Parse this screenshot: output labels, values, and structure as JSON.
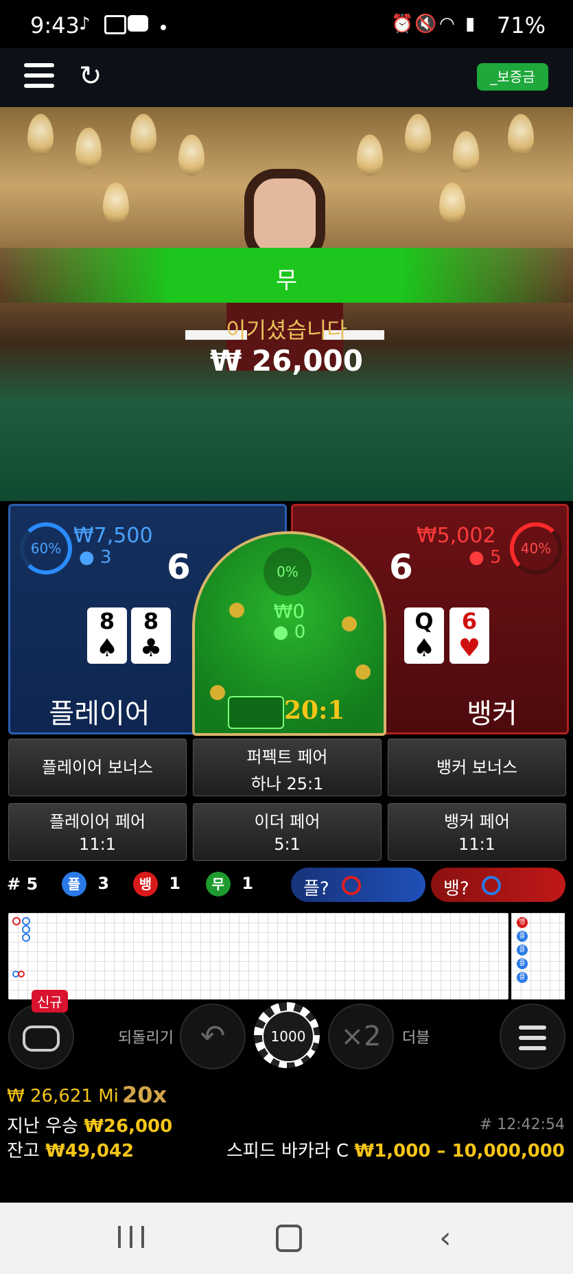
{
  "status_bar": {
    "time": "9:43",
    "battery": "71%"
  },
  "top_bar": {
    "deposit_label": "_보증금"
  },
  "video": {
    "result_label": "무",
    "won_label": "이기셨습니다",
    "won_amount": "₩ 26,000"
  },
  "player": {
    "percent": "60%",
    "amount": "₩7,500",
    "bettors": "3",
    "score": "6",
    "cards": [
      {
        "rank": "8",
        "suit": "♠"
      },
      {
        "rank": "8",
        "suit": "♣"
      }
    ],
    "label": "플레이어"
  },
  "tie": {
    "percent": "0%",
    "amount": "₩0",
    "bettors": "0",
    "payout": "20:1"
  },
  "banker": {
    "percent": "40%",
    "amount": "₩5,002",
    "bettors": "5",
    "score": "6",
    "cards": [
      {
        "rank": "Q",
        "suit": "♠"
      },
      {
        "rank": "6",
        "suit": "♥"
      }
    ],
    "label": "뱅커"
  },
  "side_bets": {
    "player_bonus": "플레이어 보너스",
    "perfect_pair_line1": "퍼펙트 페어",
    "perfect_pair_line2": "하나 25:1",
    "banker_bonus": "뱅커 보너스",
    "player_pair_line1": "플레이어 페어",
    "player_pair_line2": "11:1",
    "either_pair_line1": "이더 페어",
    "either_pair_line2": "5:1",
    "banker_pair_line1": "뱅커 페어",
    "banker_pair_line2": "11:1"
  },
  "stats": {
    "round": "# 5",
    "player_symbol": "플",
    "player_count": "3",
    "banker_symbol": "뱅",
    "banker_count": "1",
    "tie_symbol": "무",
    "tie_count": "1",
    "player_predict": "플?",
    "banker_predict": "뱅?"
  },
  "roadmap_side": [
    "뱅",
    "플",
    "플",
    "플",
    "플"
  ],
  "controls": {
    "new_badge": "신규",
    "undo_label": "되돌리기",
    "chip_value": "1000",
    "double_symbol": "×2",
    "double_label": "더블"
  },
  "bottom_info": {
    "max_line": "₩ 26,621 Mi",
    "multiplier": "20x",
    "last_win_label": "지난 우승",
    "last_win_amount": "₩26,000",
    "balance_label": "잔고",
    "balance_amount": "₩49,042",
    "game_time": "# 12:42:54",
    "table_name": "스피드 바카라 C",
    "limits": "₩1,000 – 10,000,000"
  },
  "colors": {
    "player_blue": "#2a5fb0",
    "banker_red": "#b02020",
    "tie_green": "#1cc61c",
    "gold": "#f5c518"
  }
}
